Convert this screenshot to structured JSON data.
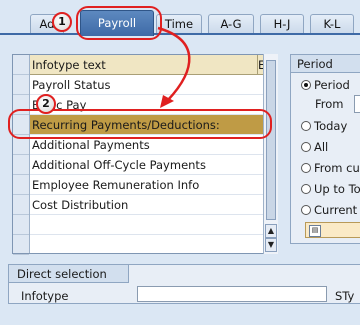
{
  "tabs": [
    {
      "label": "Ad"
    },
    {
      "label": "Payroll",
      "active": true
    },
    {
      "label": "Time"
    },
    {
      "label": "A-G"
    },
    {
      "label": "H-J"
    },
    {
      "label": "K-L"
    }
  ],
  "table": {
    "header_text": "Infotype text",
    "header_e": "E..",
    "rows": [
      {
        "text": "Payroll Status",
        "exists": true
      },
      {
        "text": "Basic Pay",
        "exists": true
      },
      {
        "text": "Recurring Payments/Deductions:",
        "exists": true,
        "selected": true
      },
      {
        "text": "Additional Payments",
        "exists": true
      },
      {
        "text": "Additional Off-Cycle Payments",
        "exists": false
      },
      {
        "text": "Employee Remuneration Info",
        "exists": false
      },
      {
        "text": "Cost Distribution",
        "exists": false
      }
    ],
    "check_glyph": "✔"
  },
  "period": {
    "title": "Period",
    "options": [
      {
        "label": "Period",
        "selected": true
      },
      {
        "label": "Today",
        "selected": false
      },
      {
        "label": "All",
        "selected": false
      },
      {
        "label": "From cu",
        "selected": false
      },
      {
        "label": "Up to To",
        "selected": false
      },
      {
        "label": "Current",
        "selected": false
      }
    ],
    "from_label": "From"
  },
  "direct_selection": {
    "title": "Direct selection",
    "infotype_label": "Infotype",
    "infotype_value": "",
    "sty_label": "STy"
  },
  "annotations": {
    "step1": "1",
    "step2": "2",
    "color": "#e02020"
  }
}
